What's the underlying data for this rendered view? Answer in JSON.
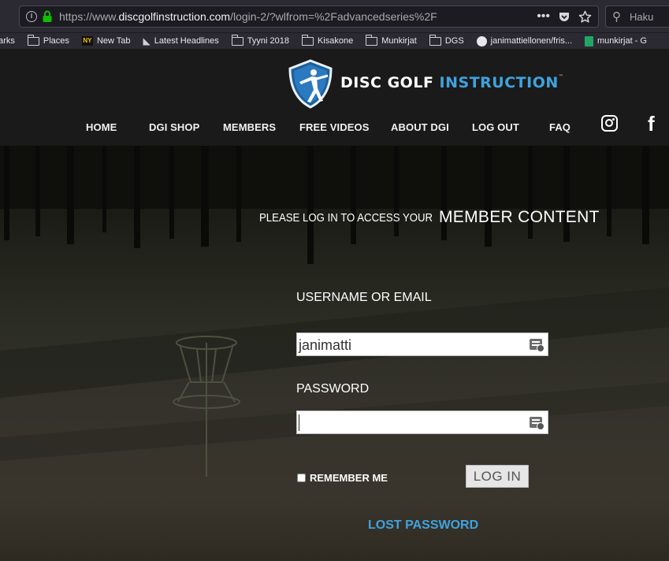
{
  "browser": {
    "url_prefix": "https://www.",
    "url_host": "discgolfinstruction.com",
    "url_path": "/login-2/?wlfrom=%2Fadvancedseries%2F",
    "search_placeholder": "Haku",
    "actions_icon": "ellipsis-icon",
    "bookmarks": [
      {
        "label": "narks",
        "icon": "folder-icon"
      },
      {
        "label": "Places",
        "icon": "folder-icon"
      },
      {
        "label": "New Tab",
        "icon": "nyt-favicon"
      },
      {
        "label": "Latest Headlines",
        "icon": "rss-icon"
      },
      {
        "label": "Tyyni 2018",
        "icon": "folder-icon"
      },
      {
        "label": "Kisakone",
        "icon": "folder-icon"
      },
      {
        "label": "Munkirjat",
        "icon": "folder-icon"
      },
      {
        "label": "DGS",
        "icon": "folder-icon"
      },
      {
        "label": "janimattiellonen/fris...",
        "icon": "github-icon"
      },
      {
        "label": "munkirjat - G",
        "icon": "sheets-icon"
      }
    ]
  },
  "site": {
    "logo": {
      "word1": "DISC GOLF",
      "word2": "INSTRUCTION",
      "tm": "™"
    },
    "nav": [
      "HOME",
      "DGI SHOP",
      "MEMBERS",
      "FREE VIDEOS",
      "ABOUT DGI",
      "LOG OUT",
      "FAQ"
    ],
    "login": {
      "title_small": "PLEASE LOG IN TO ACCESS YOUR",
      "title_big": "MEMBER CONTENT",
      "username_label": "USERNAME OR EMAIL",
      "username_value": "janimatti",
      "password_label": "PASSWORD",
      "password_value": "",
      "remember_label": "REMEMBER ME",
      "login_button": "LOG IN",
      "lost_password": "LOST PASSWORD"
    },
    "colors": {
      "accent": "#3fa3de",
      "header_bg": "#1a1a1a"
    }
  }
}
